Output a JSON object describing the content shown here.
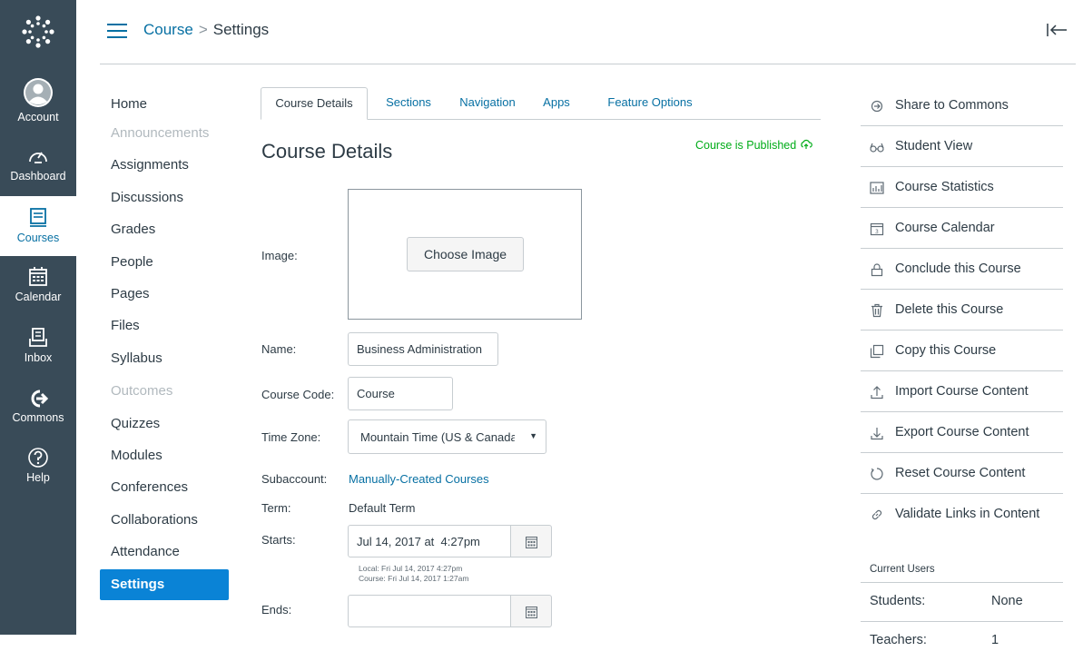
{
  "global_nav": {
    "items": [
      {
        "label": "Account"
      },
      {
        "label": "Dashboard"
      },
      {
        "label": "Courses"
      },
      {
        "label": "Calendar"
      },
      {
        "label": "Inbox"
      },
      {
        "label": "Commons"
      },
      {
        "label": "Help"
      }
    ],
    "active_color": "#0770a3",
    "background": "#394b58"
  },
  "header": {
    "breadcrumb": [
      "Course",
      "Settings"
    ],
    "separator": ">"
  },
  "course_nav": {
    "items": [
      {
        "label": "Home",
        "state": "normal"
      },
      {
        "label": "Announcements",
        "state": "disabled"
      },
      {
        "label": "Assignments",
        "state": "normal"
      },
      {
        "label": "Discussions",
        "state": "normal"
      },
      {
        "label": "Grades",
        "state": "normal"
      },
      {
        "label": "People",
        "state": "normal"
      },
      {
        "label": "Pages",
        "state": "normal"
      },
      {
        "label": "Files",
        "state": "normal"
      },
      {
        "label": "Syllabus",
        "state": "normal"
      },
      {
        "label": "Outcomes",
        "state": "disabled"
      },
      {
        "label": "Quizzes",
        "state": "normal"
      },
      {
        "label": "Modules",
        "state": "normal"
      },
      {
        "label": "Conferences",
        "state": "normal"
      },
      {
        "label": "Collaborations",
        "state": "normal"
      },
      {
        "label": "Attendance",
        "state": "normal"
      },
      {
        "label": "Settings",
        "state": "active"
      }
    ]
  },
  "tabs": [
    {
      "label": "Course Details",
      "active": true
    },
    {
      "label": "Sections",
      "active": false
    },
    {
      "label": "Navigation",
      "active": false
    },
    {
      "label": "Apps",
      "active": false
    },
    {
      "label": "Feature Options",
      "active": false
    }
  ],
  "details": {
    "title": "Course Details",
    "published_text": "Course is Published",
    "image_label": "Image:",
    "choose_image": "Choose Image",
    "name_label": "Name:",
    "name_value": "Business Administration",
    "code_label": "Course Code:",
    "code_value": "Course",
    "timezone_label": "Time Zone:",
    "timezone_value": "Mountain Time (US & Canada)",
    "subaccount_label": "Subaccount:",
    "subaccount_value": "Manually-Created Courses",
    "term_label": "Term:",
    "term_value": "Default Term",
    "starts_label": "Starts:",
    "starts_value": "Jul 14, 2017 at  4:27pm",
    "starts_local": "Local: Fri Jul 14, 2017 4:27pm",
    "starts_course": "Course: Fri Jul 14, 2017 1:27am",
    "ends_label": "Ends:",
    "ends_value": ""
  },
  "sidebar": {
    "items": [
      {
        "label": "Share to Commons",
        "icon": "share-icon"
      },
      {
        "label": "Student View",
        "icon": "glasses-icon"
      },
      {
        "label": "Course Statistics",
        "icon": "stats-icon"
      },
      {
        "label": "Course Calendar",
        "icon": "calendar-icon"
      },
      {
        "label": "Conclude this Course",
        "icon": "lock-icon"
      },
      {
        "label": "Delete this Course",
        "icon": "trash-icon"
      },
      {
        "label": "Copy this Course",
        "icon": "copy-icon"
      },
      {
        "label": "Import Course Content",
        "icon": "upload-icon"
      },
      {
        "label": "Export Course Content",
        "icon": "download-icon"
      },
      {
        "label": "Reset Course Content",
        "icon": "reset-icon"
      },
      {
        "label": "Validate Links in Content",
        "icon": "link-icon"
      }
    ],
    "current_users_title": "Current Users",
    "users": [
      {
        "role": "Students:",
        "count": "None"
      },
      {
        "role": "Teachers:",
        "count": "1"
      }
    ]
  }
}
